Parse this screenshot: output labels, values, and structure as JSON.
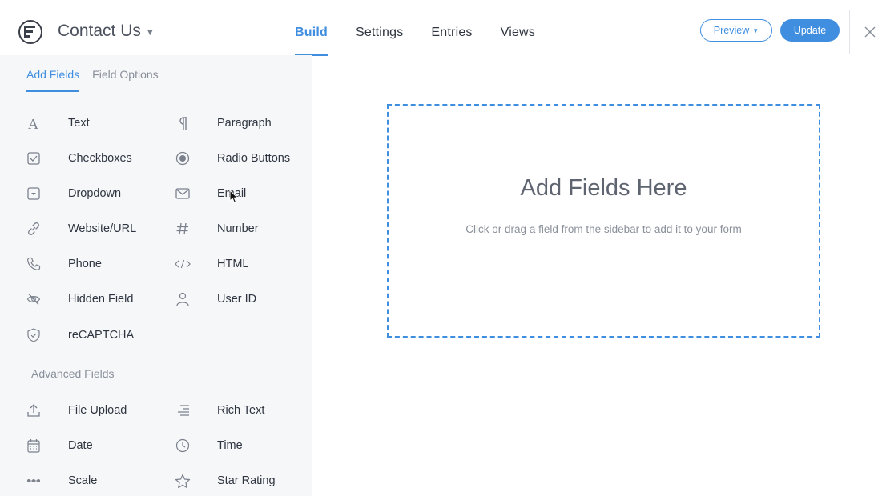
{
  "header": {
    "form_title": "Contact Us",
    "tabs": [
      {
        "label": "Build",
        "active": true
      },
      {
        "label": "Settings",
        "active": false
      },
      {
        "label": "Entries",
        "active": false
      },
      {
        "label": "Views",
        "active": false
      }
    ],
    "preview_label": "Preview",
    "update_label": "Update",
    "close_icon": "close-icon"
  },
  "sidebar": {
    "tabs": [
      {
        "label": "Add Fields",
        "active": true
      },
      {
        "label": "Field Options",
        "active": false
      }
    ],
    "fields": [
      {
        "label": "Text",
        "icon": "text-icon"
      },
      {
        "label": "Paragraph",
        "icon": "paragraph-icon"
      },
      {
        "label": "Checkboxes",
        "icon": "checkbox-icon"
      },
      {
        "label": "Radio Buttons",
        "icon": "radio-icon"
      },
      {
        "label": "Dropdown",
        "icon": "dropdown-icon"
      },
      {
        "label": "Email",
        "icon": "envelope-icon"
      },
      {
        "label": "Website/URL",
        "icon": "link-icon"
      },
      {
        "label": "Number",
        "icon": "hash-icon"
      },
      {
        "label": "Phone",
        "icon": "phone-icon"
      },
      {
        "label": "HTML",
        "icon": "code-icon"
      },
      {
        "label": "Hidden Field",
        "icon": "eye-slash-icon"
      },
      {
        "label": "User ID",
        "icon": "user-icon"
      },
      {
        "label": "reCAPTCHA",
        "icon": "shield-icon"
      }
    ],
    "advanced_heading": "Advanced Fields",
    "advanced_fields": [
      {
        "label": "File Upload",
        "icon": "upload-icon"
      },
      {
        "label": "Rich Text",
        "icon": "align-right-icon"
      },
      {
        "label": "Date",
        "icon": "calendar-icon"
      },
      {
        "label": "Time",
        "icon": "clock-icon"
      },
      {
        "label": "Scale",
        "icon": "scale-icon"
      },
      {
        "label": "Star Rating",
        "icon": "star-icon"
      }
    ]
  },
  "canvas": {
    "title": "Add Fields Here",
    "subtitle": "Click or drag a field from the sidebar to add it to your form"
  },
  "colors": {
    "accent": "#3f8ee0",
    "sidebar_bg": "#f6f7f9",
    "text": "#2f3540",
    "muted": "#8a909a"
  }
}
